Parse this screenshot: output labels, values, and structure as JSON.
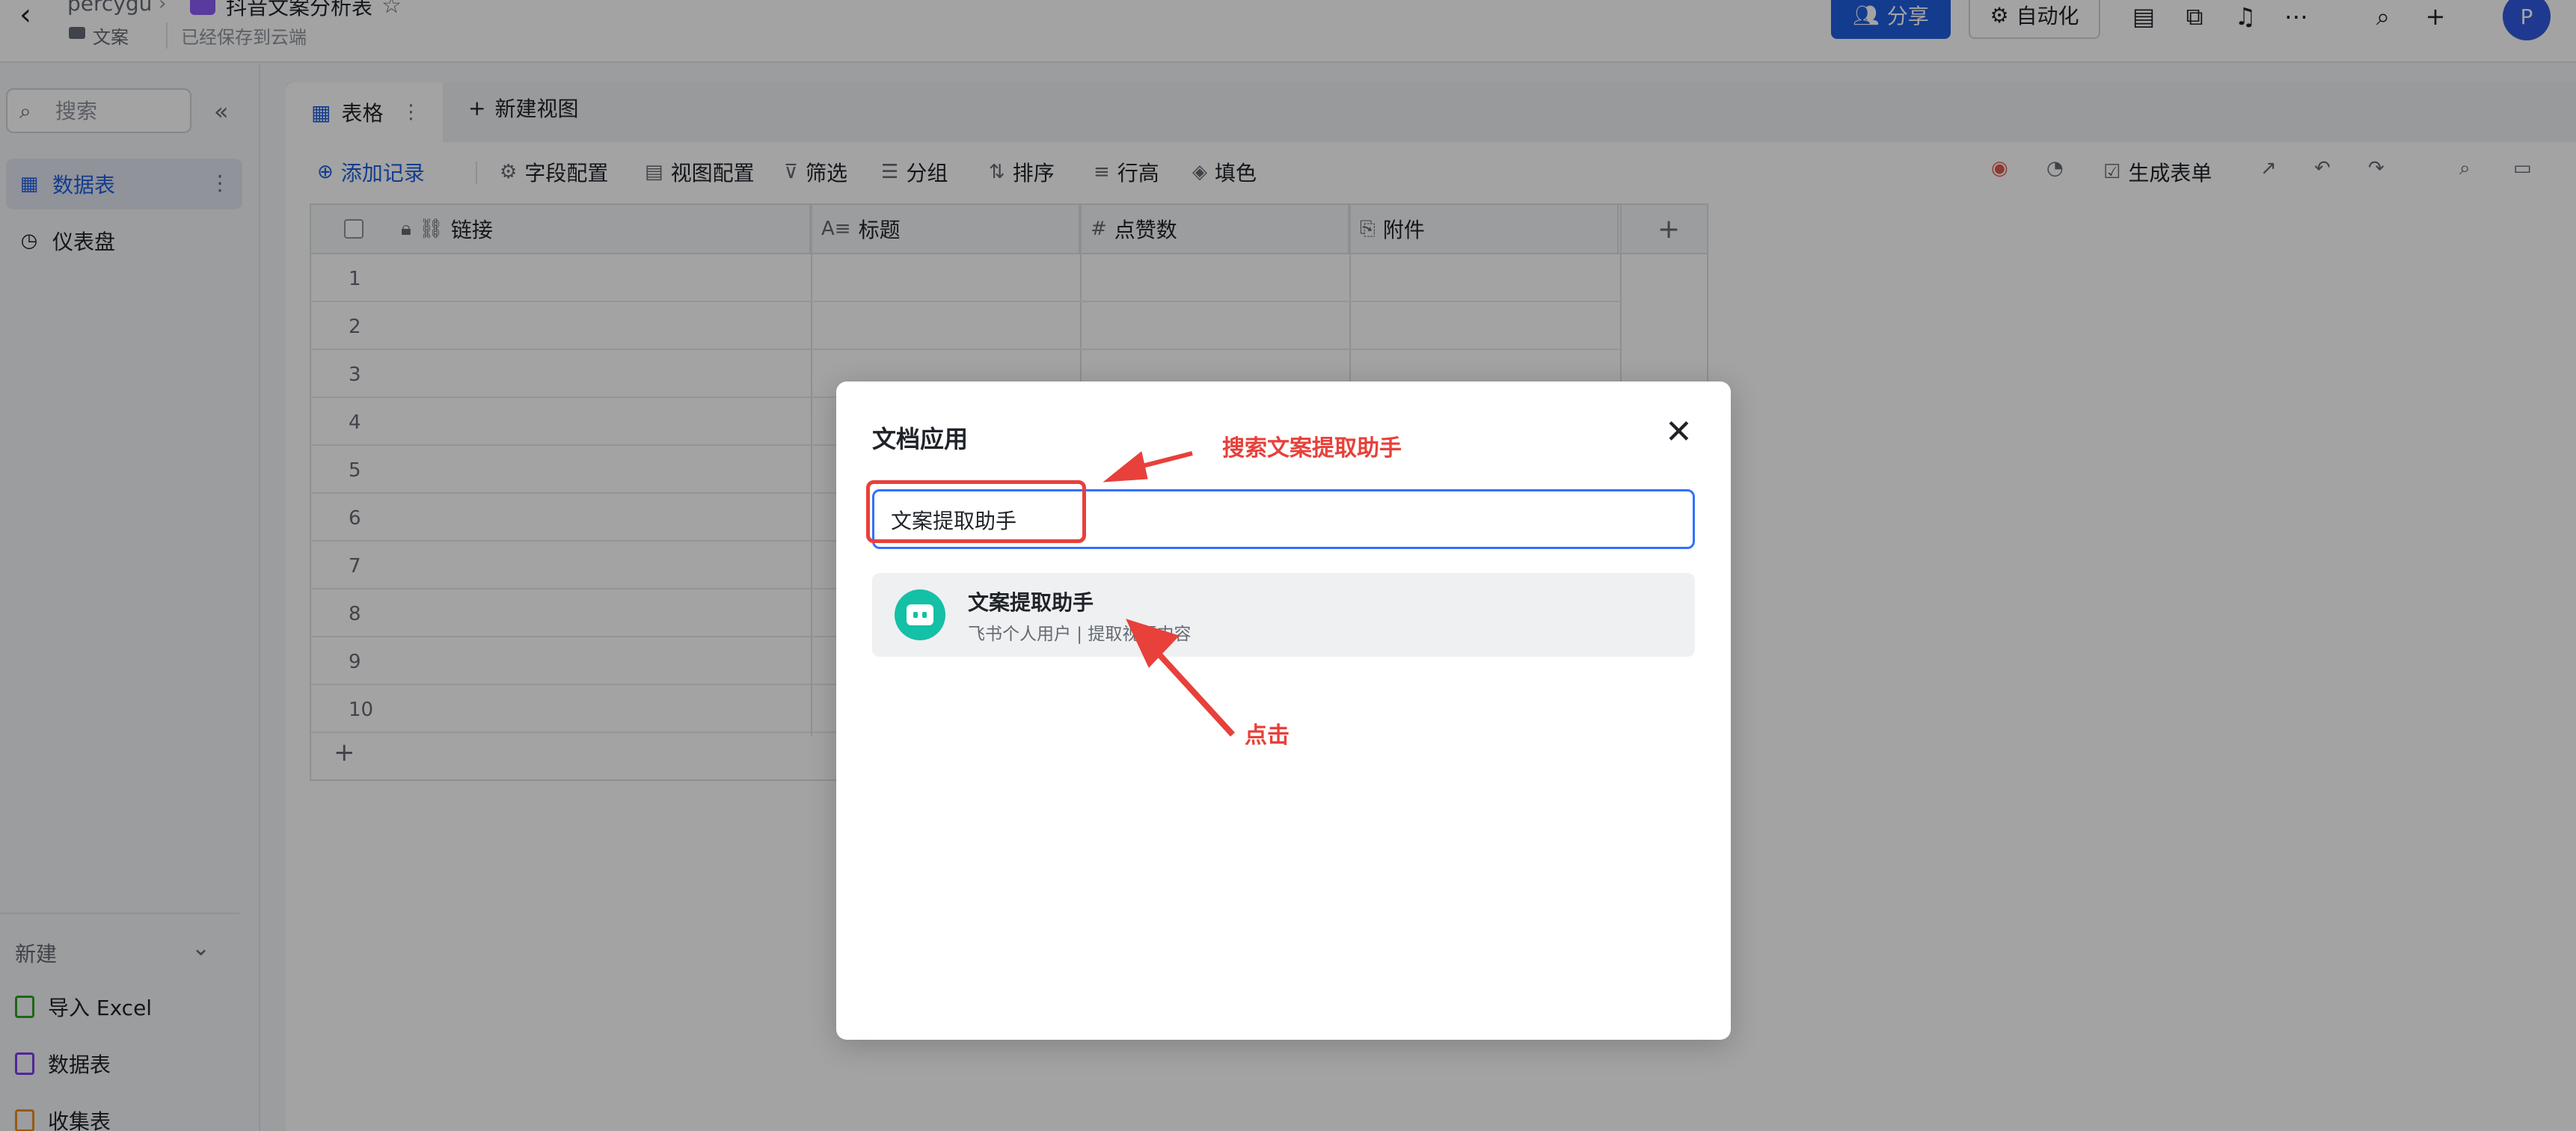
{
  "header": {
    "owner": "percygu",
    "doc_title": "抖音文案分析表",
    "folder": "文案",
    "save_status": "已经保存到云端",
    "share_label": "分享",
    "automation_label": "自动化",
    "avatar_letter": "P"
  },
  "sidebar": {
    "search_placeholder": "搜索",
    "items": [
      {
        "label": "数据表",
        "icon": "table-icon",
        "active": true
      },
      {
        "label": "仪表盘",
        "icon": "dashboard-icon",
        "active": false
      }
    ],
    "new_section": {
      "label": "新建",
      "items": [
        {
          "label": "导入 Excel",
          "icon": "excel-icon",
          "color": "#2ea121"
        },
        {
          "label": "数据表",
          "icon": "table-icon",
          "color": "#7f3bf5"
        },
        {
          "label": "收集表",
          "icon": "form-icon",
          "color": "#f08c1a"
        }
      ]
    }
  },
  "view_tabs": {
    "active_label": "表格",
    "new_view_label": "新建视图"
  },
  "toolbar": {
    "add_record": "添加记录",
    "field_config": "字段配置",
    "view_config": "视图配置",
    "filter": "筛选",
    "group": "分组",
    "sort": "排序",
    "row_height": "行高",
    "fill_color": "填色",
    "generate_form": "生成表单"
  },
  "grid": {
    "columns": [
      {
        "label": "链接",
        "icon": "link-icon"
      },
      {
        "label": "标题",
        "icon": "text-icon"
      },
      {
        "label": "点赞数",
        "icon": "number-icon"
      },
      {
        "label": "附件",
        "icon": "attachment-icon"
      }
    ],
    "row_numbers": [
      "1",
      "2",
      "3",
      "4",
      "5",
      "6",
      "7",
      "8",
      "9",
      "10"
    ]
  },
  "modal": {
    "title": "文档应用",
    "search_value": "文案提取助手",
    "result": {
      "name": "文案提取助手",
      "description": "飞书个人用户 | 提取视频内容"
    }
  },
  "annotations": {
    "search_hint": "搜索文案提取助手",
    "click_hint": "点击",
    "color": "#e8403a"
  },
  "colors": {
    "accent": "#1f5fe0",
    "focus": "#3370ff",
    "bot": "#14c0a6"
  }
}
